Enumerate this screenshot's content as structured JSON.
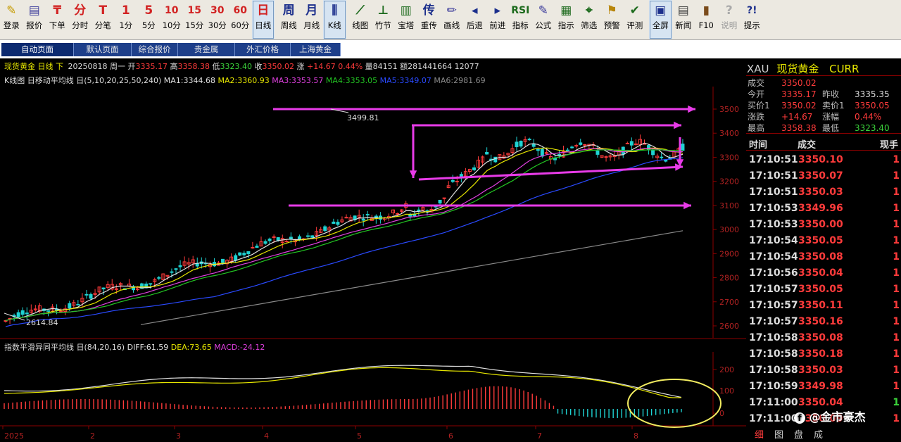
{
  "toolbar": [
    {
      "label": "登录",
      "icon": "✎",
      "icon_name": "pencil-login-icon",
      "color": "#c69b00"
    },
    {
      "label": "报价",
      "icon": "▤",
      "icon_name": "quote-list-icon",
      "color": "#3a3a9a"
    },
    {
      "label": "下单",
      "icon": "₸",
      "icon_name": "order-icon",
      "color": "#d22222"
    },
    {
      "label": "分时",
      "icon": "分",
      "icon_name": "intraday-icon",
      "color": "#d22222"
    },
    {
      "label": "分笔",
      "icon": "T",
      "icon_name": "tick-icon",
      "color": "#d22222"
    },
    {
      "label": "1分",
      "icon": "1",
      "icon_name": "minute-1-icon",
      "color": "#d22222"
    },
    {
      "label": "5分",
      "icon": "5",
      "icon_name": "minute-5-icon",
      "color": "#d22222"
    },
    {
      "label": "10分",
      "icon": "10",
      "icon_name": "minute-10-icon",
      "color": "#d22222"
    },
    {
      "label": "15分",
      "icon": "15",
      "icon_name": "minute-15-icon",
      "color": "#d22222"
    },
    {
      "label": "30分",
      "icon": "30",
      "icon_name": "minute-30-icon",
      "color": "#d22222"
    },
    {
      "label": "60分",
      "icon": "60",
      "icon_name": "minute-60-icon",
      "color": "#d22222"
    },
    {
      "label": "日线",
      "icon": "日",
      "icon_name": "daily-icon",
      "color": "#d22222",
      "active": true
    },
    {
      "label": "周线",
      "icon": "周",
      "icon_name": "weekly-icon",
      "color": "#1c2f8c"
    },
    {
      "label": "月线",
      "icon": "月",
      "icon_name": "monthly-icon",
      "color": "#1c2f8c"
    },
    {
      "label": "K线",
      "icon": "⫼",
      "icon_name": "kline-icon",
      "color": "#1c2f8c",
      "active": true
    },
    {
      "label": "线图",
      "icon": "⟋",
      "icon_name": "line-chart-icon",
      "color": "#1c6a1c"
    },
    {
      "label": "竹节",
      "icon": "⊥",
      "icon_name": "bamboo-icon",
      "color": "#1c6a1c"
    },
    {
      "label": "宝塔",
      "icon": "▥",
      "icon_name": "tower-icon",
      "color": "#1c6a1c"
    },
    {
      "label": "重传",
      "icon": "传",
      "icon_name": "reload-icon",
      "color": "#1c2f8c"
    },
    {
      "label": "画线",
      "icon": "✏",
      "icon_name": "draw-line-icon",
      "color": "#3a3a9a"
    },
    {
      "label": "后退",
      "icon": "◂",
      "icon_name": "back-icon",
      "color": "#1c2f8c"
    },
    {
      "label": "前进",
      "icon": "▸",
      "icon_name": "forward-icon",
      "color": "#1c2f8c"
    },
    {
      "label": "指标",
      "icon": "RSI",
      "icon_name": "indicator-icon",
      "color": "#1c6a1c"
    },
    {
      "label": "公式",
      "icon": "✎",
      "icon_name": "formula-icon",
      "color": "#3a3a9a"
    },
    {
      "label": "指示",
      "icon": "▦",
      "icon_name": "indicator-panel-icon",
      "color": "#1c6a1c"
    },
    {
      "label": "筛选",
      "icon": "⌖",
      "icon_name": "binocular-filter-icon",
      "color": "#1c6a1c"
    },
    {
      "label": "预警",
      "icon": "⚑",
      "icon_name": "alert-icon",
      "color": "#b8860b"
    },
    {
      "label": "评测",
      "icon": "✔",
      "icon_name": "evaluate-icon",
      "color": "#1c6a1c"
    },
    {
      "label": "全屏",
      "icon": "▣",
      "icon_name": "fullscreen-icon",
      "color": "#1c2f8c",
      "active": true
    },
    {
      "label": "新闻",
      "icon": "▤",
      "icon_name": "news-icon",
      "color": "#3a3a3a"
    },
    {
      "label": "F10",
      "icon": "▮",
      "icon_name": "f10-books-icon",
      "color": "#7a4b1a"
    },
    {
      "label": "说明",
      "icon": "?",
      "icon_name": "help-disabled-icon",
      "color": "#aaaaaa",
      "disabled": true
    },
    {
      "label": "提示",
      "icon": "?!",
      "icon_name": "hint-icon",
      "color": "#1c2f8c"
    }
  ],
  "tabs": [
    {
      "label": "自动页面",
      "active": true
    },
    {
      "label": "默认页面"
    },
    {
      "label": "综合报价"
    },
    {
      "label": "贵金属"
    },
    {
      "label": "外汇价格"
    },
    {
      "label": "上海黄金"
    }
  ],
  "info_line": {
    "name": "现货黄金",
    "period": "日线",
    "direction": "下",
    "date": "20250818",
    "weekday": "周一",
    "open_label": "开",
    "open": "3335.17",
    "high_label": "高",
    "high": "3358.38",
    "low_label": "低",
    "low": "3323.40",
    "close_label": "收",
    "close": "3350.02",
    "change_label": "涨",
    "change": "+14.67",
    "change_pct": "0.44%",
    "volume_label": "量",
    "volume": "84151",
    "amount_label": "额",
    "amount": "281441664",
    "extra": "12077"
  },
  "ma_line": {
    "title": "K线图 日移动平均线 日(5,10,20,25,50,240)",
    "ma1": "MA1:3344.68",
    "ma2": "MA2:3360.93",
    "ma3": "MA3:3353.57",
    "ma4": "MA4:3353.05",
    "ma5": "MA5:3349.07",
    "ma6": "MA6:2981.69"
  },
  "macd_line": {
    "title": "指数平滑异同平均线 日(84,20,16)",
    "diff": "DIFF:61.59",
    "dea": "DEA:73.65",
    "macd": "MACD:-24.12"
  },
  "chart_data": {
    "type": "candlestick",
    "price_axis_ticks": [
      "3500",
      "3400",
      "3300",
      "3200",
      "3100",
      "3000",
      "2900",
      "2800",
      "2700",
      "2600"
    ],
    "macd_axis_ticks": [
      "200",
      "100",
      "0"
    ],
    "x_labels": [
      "2025",
      "2",
      "3",
      "4",
      "5",
      "6",
      "7",
      "8"
    ],
    "annotations": {
      "high_label": "3499.81",
      "low_label": "2614.84"
    },
    "colors": {
      "up": "#ff3b3b",
      "down": "#1fd3d3",
      "ma1": "#e0e0e0",
      "ma2": "#e6e600",
      "ma3": "#e040e0",
      "ma4": "#22c422",
      "ma5": "#2a4aff",
      "ma6": "#8a8a8a",
      "arrow": "#e83be8",
      "circle": "#f2ec60"
    }
  },
  "quote_panel": {
    "symbol": "XAU",
    "name": "现货黄金",
    "suffix": "CURR",
    "rows": [
      {
        "l1": "成交",
        "v1": "3350.02",
        "l2": "",
        "v2": ""
      },
      {
        "l1": "今开",
        "v1": "3335.17",
        "l2": "昨收",
        "v2": "3335.35"
      },
      {
        "l1": "买价1",
        "v1": "3350.02",
        "l2": "卖价1",
        "v2": "3350.05"
      },
      {
        "l1": "涨跌",
        "v1": "+14.67",
        "l2": "涨幅",
        "v2": "0.44%"
      },
      {
        "l1": "最高",
        "v1": "3358.38",
        "l2": "最低",
        "v2": "3323.40"
      }
    ],
    "tick_headers": {
      "time": "时间",
      "price": "成交",
      "vol": "现手"
    },
    "ticks": [
      {
        "time": "17:10:51",
        "price": "3350.10",
        "vol": "1"
      },
      {
        "time": "17:10:51",
        "price": "3350.07",
        "vol": "1"
      },
      {
        "time": "17:10:51",
        "price": "3350.03",
        "vol": "1"
      },
      {
        "time": "17:10:53",
        "price": "3349.96",
        "vol": "1"
      },
      {
        "time": "17:10:53",
        "price": "3350.00",
        "vol": "1"
      },
      {
        "time": "17:10:54",
        "price": "3350.05",
        "vol": "1"
      },
      {
        "time": "17:10:54",
        "price": "3350.08",
        "vol": "1"
      },
      {
        "time": "17:10:56",
        "price": "3350.04",
        "vol": "1"
      },
      {
        "time": "17:10:57",
        "price": "3350.05",
        "vol": "1"
      },
      {
        "time": "17:10:57",
        "price": "3350.11",
        "vol": "1"
      },
      {
        "time": "17:10:57",
        "price": "3350.16",
        "vol": "1"
      },
      {
        "time": "17:10:58",
        "price": "3350.08",
        "vol": "1"
      },
      {
        "time": "17:10:58",
        "price": "3350.18",
        "vol": "1"
      },
      {
        "time": "17:10:58",
        "price": "3350.03",
        "vol": "1"
      },
      {
        "time": "17:10:59",
        "price": "3349.98",
        "vol": "1"
      },
      {
        "time": "17:11:00",
        "price": "3350.04",
        "vol": "1"
      },
      {
        "time": "17:11:00",
        "price": "3350.09",
        "vol": "1"
      }
    ],
    "bottom_tabs": [
      "细",
      "图",
      "盘",
      "成"
    ],
    "watermark": "@金市豪杰"
  }
}
